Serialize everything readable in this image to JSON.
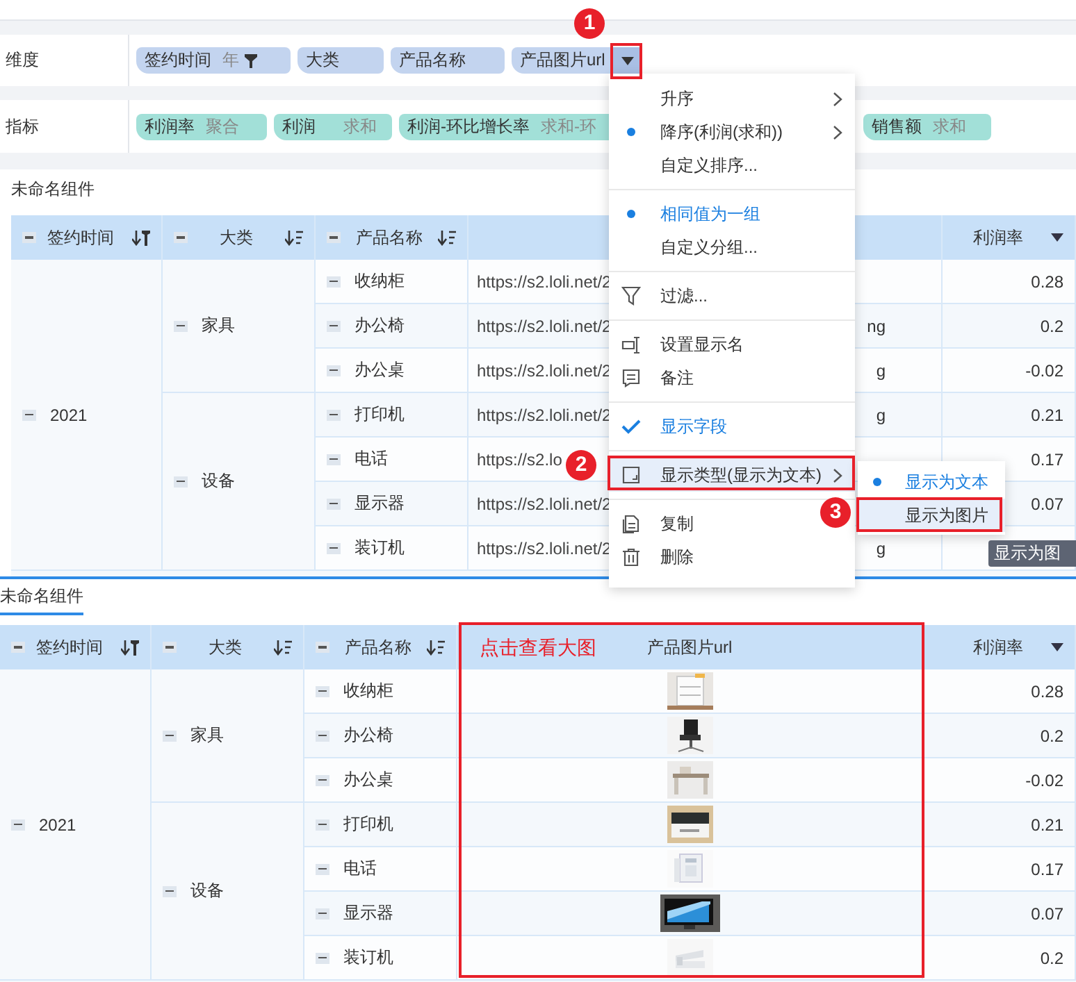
{
  "dimensions": {
    "label": "维度",
    "fields": [
      {
        "name": "签约时间",
        "suffix": "年",
        "filtered": true,
        "menu_open": false
      },
      {
        "name": "大类",
        "filtered": false,
        "menu_open": false
      },
      {
        "name": "产品名称",
        "filtered": false,
        "menu_open": false
      },
      {
        "name": "产品图片url",
        "filtered": false,
        "menu_open": true
      }
    ]
  },
  "metrics": {
    "label": "指标",
    "fields": [
      {
        "name": "利润率",
        "aggregation": "聚合"
      },
      {
        "name": "利润",
        "aggregation": "求和"
      },
      {
        "name": "利润-环比增长率",
        "aggregation": "求和-环"
      },
      {
        "name": "销售额",
        "aggregation": "求和"
      }
    ]
  },
  "components": [
    {
      "title": "未命名组件",
      "table": {
        "columns": [
          {
            "label": "签约时间"
          },
          {
            "label": "大类"
          },
          {
            "label": "产品名称"
          },
          {},
          {
            "label": "利润率"
          }
        ],
        "rows": [
          {
            "year": "2021",
            "categories": [
              {
                "name": "家具",
                "products": [
                  {
                    "name": "收纳柜",
                    "url": "https://s2.loli.net/2",
                    "profit_rate": "0.28"
                  },
                  {
                    "name": "办公椅",
                    "url": "https://s2.loli.net/2",
                    "url_tail": "ng",
                    "profit_rate": "0.2"
                  },
                  {
                    "name": "办公桌",
                    "url": "https://s2.loli.net/2",
                    "url_tail": "g",
                    "profit_rate": "-0.02"
                  }
                ]
              },
              {
                "name": "设备",
                "products": [
                  {
                    "name": "打印机",
                    "url": "https://s2.loli.net/2",
                    "url_tail": "g",
                    "profit_rate": "0.21"
                  },
                  {
                    "name": "电话",
                    "url": "https://s2.lo",
                    "profit_rate": "0.17"
                  },
                  {
                    "name": "显示器",
                    "url": "https://s2.loli.net/2",
                    "profit_rate": "0.07"
                  },
                  {
                    "name": "装订机",
                    "url": "https://s2.loli.net/2",
                    "url_tail": "g"
                  }
                ]
              }
            ]
          }
        ]
      }
    },
    {
      "title": "未命名组件",
      "table": {
        "columns": [
          {
            "label": "签约时间"
          },
          {
            "label": "大类"
          },
          {
            "label": "产品名称"
          },
          {
            "label": "产品图片url"
          },
          {
            "label": "利润率"
          }
        ],
        "rows": [
          {
            "year": "2021",
            "categories": [
              {
                "name": "家具",
                "products": [
                  {
                    "name": "收纳柜",
                    "profit_rate": "0.28"
                  },
                  {
                    "name": "办公椅",
                    "profit_rate": "0.2"
                  },
                  {
                    "name": "办公桌",
                    "profit_rate": "-0.02"
                  }
                ]
              },
              {
                "name": "设备",
                "products": [
                  {
                    "name": "打印机",
                    "profit_rate": "0.21"
                  },
                  {
                    "name": "电话",
                    "profit_rate": "0.17"
                  },
                  {
                    "name": "显示器",
                    "profit_rate": "0.07"
                  },
                  {
                    "name": "装订机",
                    "profit_rate": "0.2"
                  }
                ]
              }
            ]
          }
        ]
      }
    }
  ],
  "context_menu": {
    "groups": [
      [
        {
          "label": "升序",
          "kind": "plain",
          "selected": false,
          "active": false,
          "submenu": true,
          "highlighted": false
        },
        {
          "label": "降序(利润(求和))",
          "kind": "plain",
          "selected": true,
          "active": false,
          "submenu": true,
          "highlighted": false
        },
        {
          "label": "自定义排序...",
          "kind": "plain",
          "selected": false,
          "active": false,
          "submenu": false,
          "highlighted": false
        }
      ],
      [
        {
          "label": "相同值为一组",
          "kind": "plain",
          "selected": true,
          "active": true,
          "submenu": false,
          "highlighted": false
        },
        {
          "label": "自定义分组...",
          "kind": "plain",
          "selected": false,
          "active": false,
          "submenu": false,
          "highlighted": false
        }
      ],
      [
        {
          "label": "过滤...",
          "kind": "filter",
          "selected": false,
          "active": false,
          "submenu": false,
          "highlighted": false
        }
      ],
      [
        {
          "label": "设置显示名",
          "kind": "rename",
          "selected": false,
          "active": false,
          "submenu": false,
          "highlighted": false
        },
        {
          "label": "备注",
          "kind": "note",
          "selected": false,
          "active": false,
          "submenu": false,
          "highlighted": false
        }
      ],
      [
        {
          "label": "显示字段",
          "kind": "check",
          "selected": false,
          "active": true,
          "submenu": false,
          "highlighted": false
        }
      ],
      [
        {
          "label": "显示类型(显示为文本)",
          "kind": "display",
          "selected": false,
          "active": false,
          "submenu": true,
          "highlighted": true
        }
      ],
      [
        {
          "label": "复制",
          "kind": "copy",
          "selected": false,
          "active": false,
          "submenu": false,
          "highlighted": false
        },
        {
          "label": "删除",
          "kind": "delete",
          "selected": false,
          "active": false,
          "submenu": false,
          "highlighted": false
        }
      ]
    ],
    "submenu": {
      "items": [
        {
          "label": "显示为文本",
          "selected": true,
          "highlighted": false
        },
        {
          "label": "显示为图片",
          "selected": false,
          "highlighted": true
        }
      ]
    }
  },
  "tooltip": "显示为图",
  "annotations": {
    "badges": [
      "1",
      "2",
      "3"
    ],
    "note": "点击查看大图"
  }
}
